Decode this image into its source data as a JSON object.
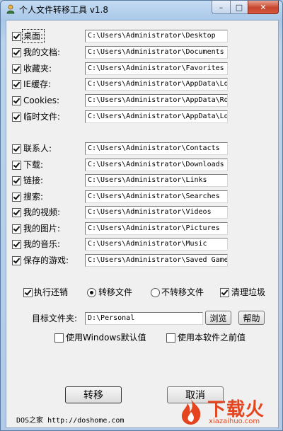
{
  "window": {
    "title": "个人文件转移工具 v1.8",
    "min": "–",
    "max": "□",
    "close": "✕"
  },
  "folders_group1": [
    {
      "label": "桌面:",
      "path": "C:\\Users\\Administrator\\Desktop",
      "checked": true
    },
    {
      "label": "我的文档:",
      "path": "C:\\Users\\Administrator\\Documents",
      "checked": true
    },
    {
      "label": "收藏夹:",
      "path": "C:\\Users\\Administrator\\Favorites",
      "checked": true
    },
    {
      "label": "IE缓存:",
      "path": "C:\\Users\\Administrator\\AppData\\Local",
      "checked": true
    },
    {
      "label": "Cookies:",
      "path": "C:\\Users\\Administrator\\AppData\\Roami",
      "checked": true
    },
    {
      "label": "临时文件:",
      "path": "C:\\Users\\Administrator\\AppData\\Local",
      "checked": true
    }
  ],
  "folders_group2": [
    {
      "label": "联系人:",
      "path": "C:\\Users\\Administrator\\Contacts",
      "checked": true
    },
    {
      "label": "下载:",
      "path": "C:\\Users\\Administrator\\Downloads",
      "checked": true
    },
    {
      "label": "链接:",
      "path": "C:\\Users\\Administrator\\Links",
      "checked": true
    },
    {
      "label": "搜索:",
      "path": "C:\\Users\\Administrator\\Searches",
      "checked": true
    },
    {
      "label": "我的视频:",
      "path": "C:\\Users\\Administrator\\Videos",
      "checked": true
    },
    {
      "label": "我的图片:",
      "path": "C:\\Users\\Administrator\\Pictures",
      "checked": true
    },
    {
      "label": "我的音乐:",
      "path": "C:\\Users\\Administrator\\Music",
      "checked": true
    },
    {
      "label": "保存的游戏:",
      "path": "C:\\Users\\Administrator\\Saved Games",
      "checked": true
    }
  ],
  "options": {
    "undo": "执行还销",
    "move_files": "转移文件",
    "no_move": "不转移文件",
    "clean": "清理垃圾"
  },
  "target": {
    "label": "目标文件夹:",
    "value": "D:\\Personal",
    "browse": "浏览",
    "help": "帮助"
  },
  "defaults": {
    "windows_default": "使用Windows默认值",
    "previous": "使用本软件之前值"
  },
  "actions": {
    "move": "转移",
    "cancel": "取消"
  },
  "footer": {
    "credit": "DOS之家 http://doshome.com"
  },
  "watermark": {
    "text": "下载火",
    "sub": "xiazaihuo.com"
  },
  "colors": {
    "title_accent": "#a8c7e8",
    "close": "#c7452c",
    "brand": "#e4451f"
  }
}
